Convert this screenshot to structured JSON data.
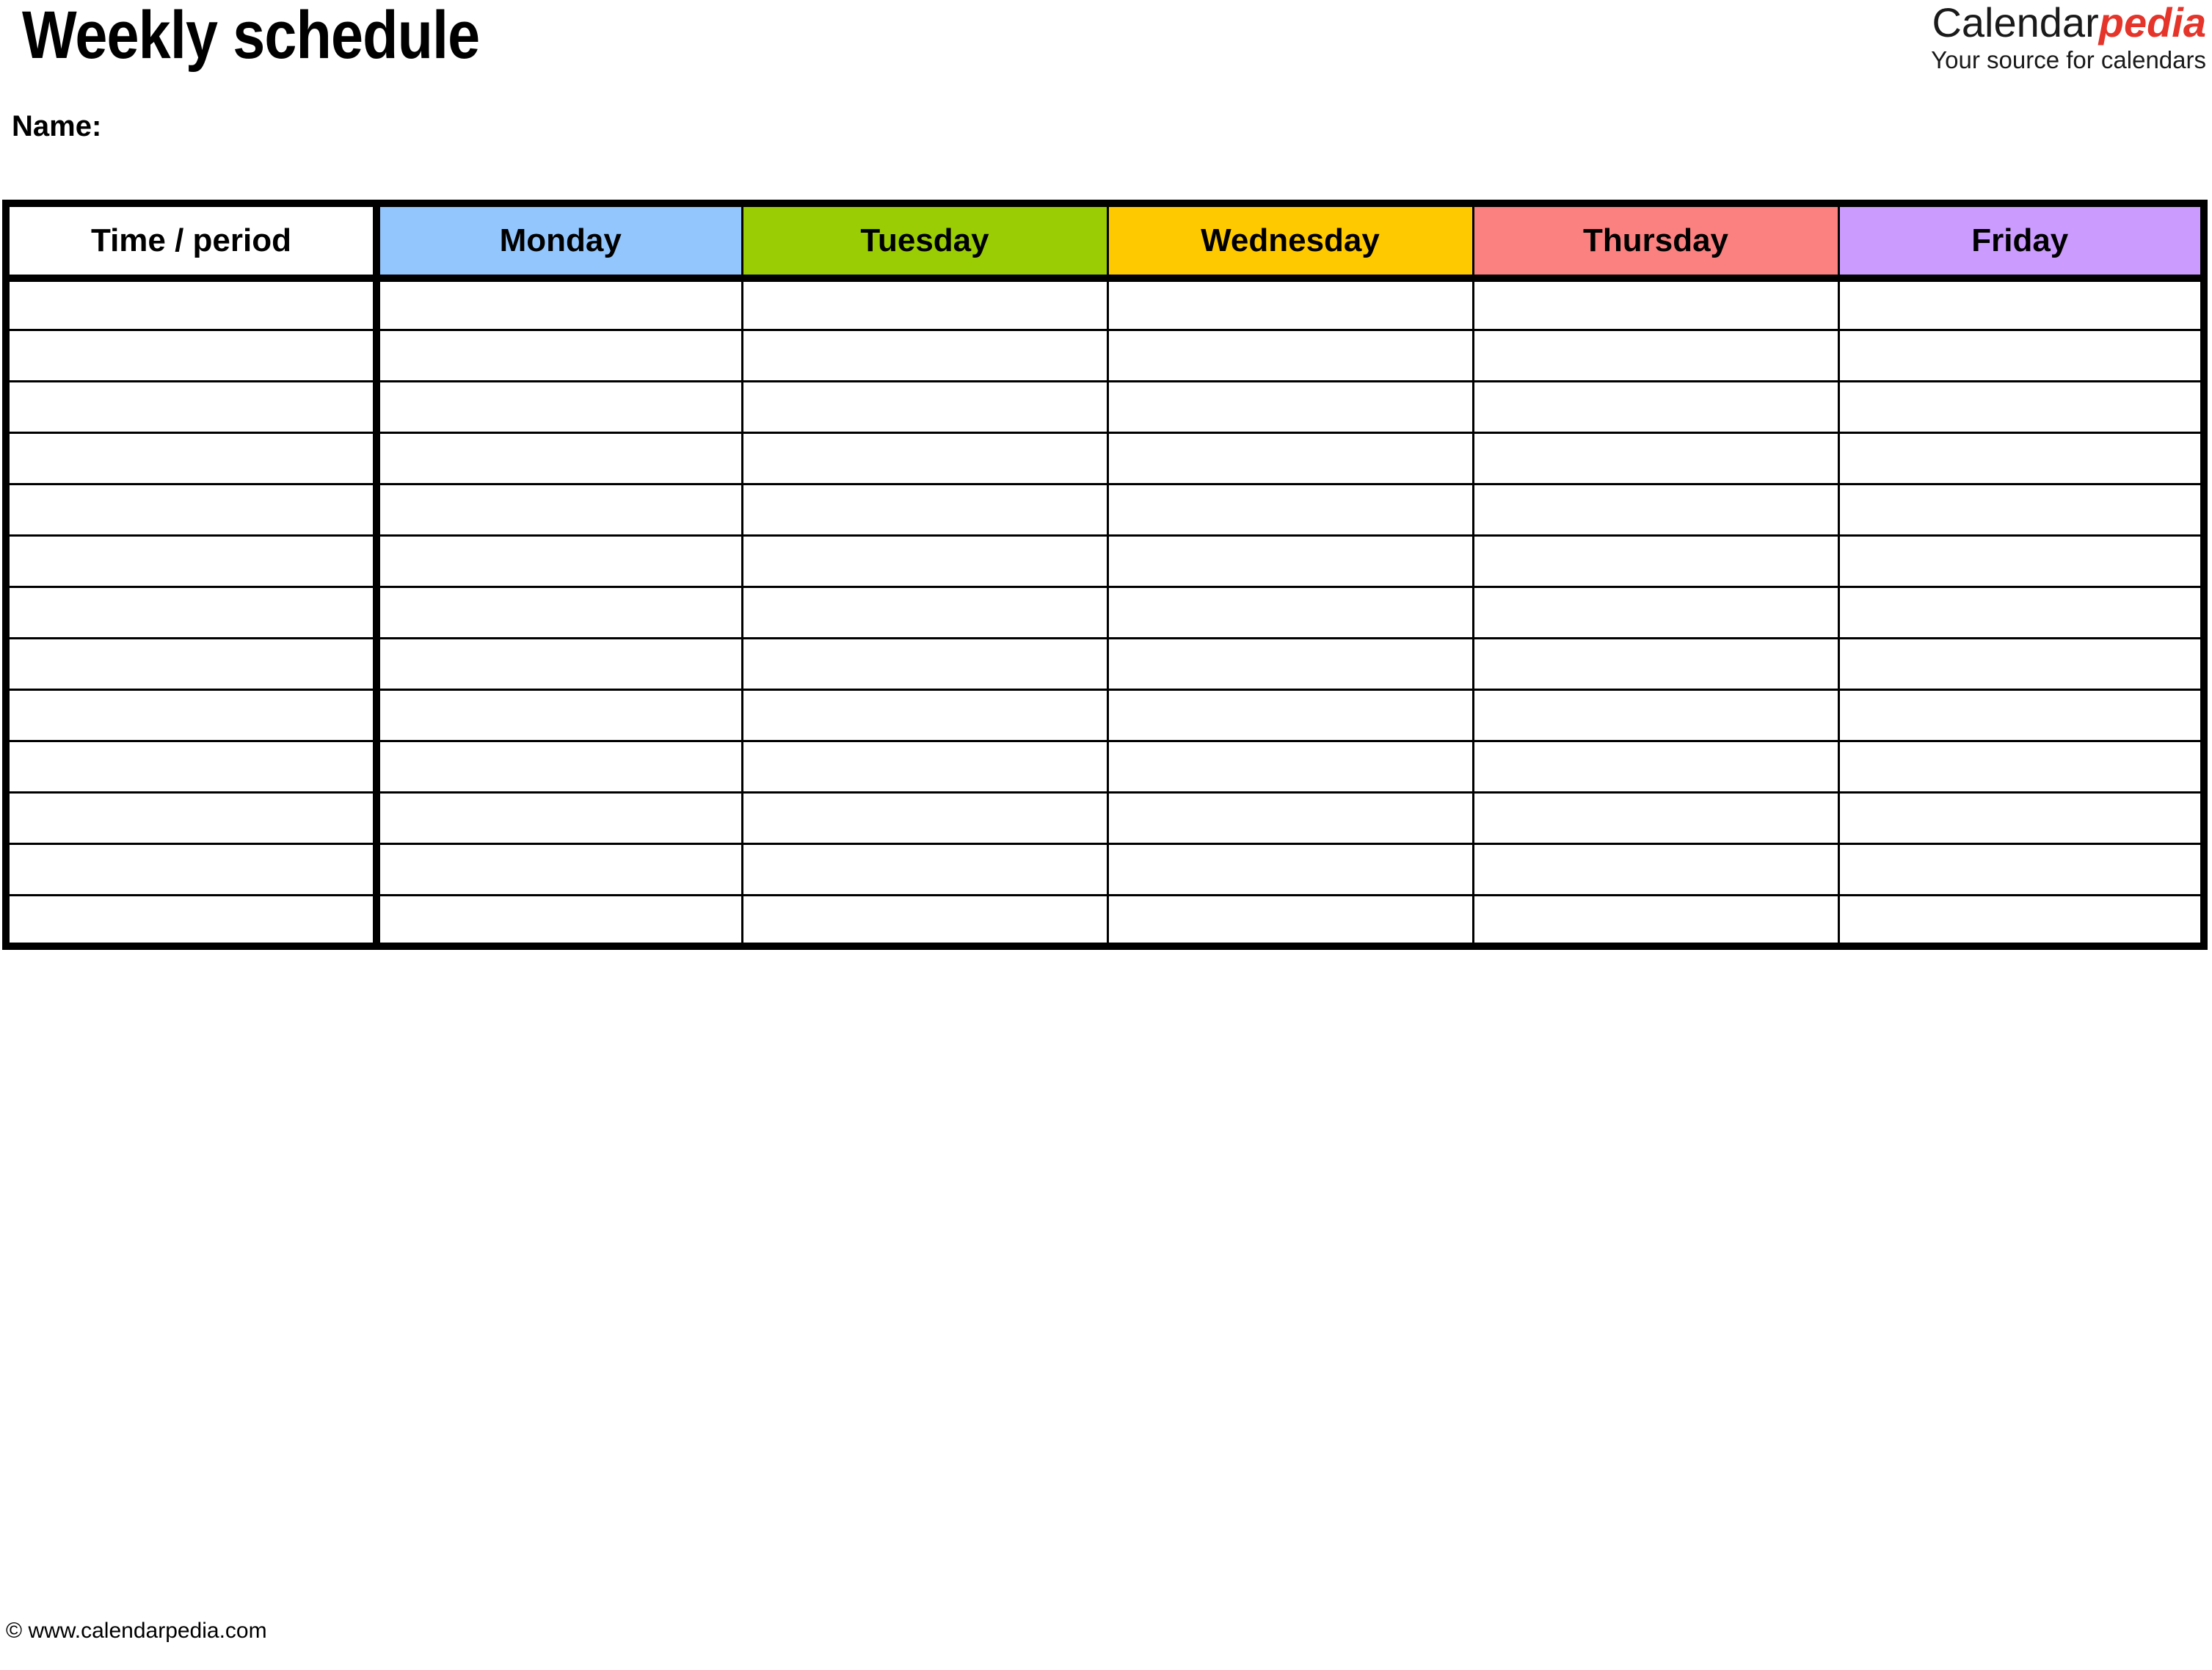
{
  "document": {
    "title": "Weekly schedule",
    "name_label": "Name:"
  },
  "logo": {
    "brand_first": "Calendar",
    "brand_second": "pedia",
    "tagline": "Your source for calendars",
    "brand_second_color": "#e5342a",
    "brand_first_color": "#1a1a1a"
  },
  "table": {
    "columns": [
      {
        "label": "Time / period",
        "color": "#ffffff",
        "key": "time"
      },
      {
        "label": "Monday",
        "color": "#93c6fd",
        "key": "monday"
      },
      {
        "label": "Tuesday",
        "color": "#9acd04",
        "key": "tuesday"
      },
      {
        "label": "Wednesday",
        "color": "#ffc900",
        "key": "wednesday"
      },
      {
        "label": "Thursday",
        "color": "#fb8180",
        "key": "thursday"
      },
      {
        "label": "Friday",
        "color": "#cb9bfd",
        "key": "friday"
      }
    ],
    "row_count": 13,
    "rows": [
      {
        "time": "",
        "monday": "",
        "tuesday": "",
        "wednesday": "",
        "thursday": "",
        "friday": ""
      },
      {
        "time": "",
        "monday": "",
        "tuesday": "",
        "wednesday": "",
        "thursday": "",
        "friday": ""
      },
      {
        "time": "",
        "monday": "",
        "tuesday": "",
        "wednesday": "",
        "thursday": "",
        "friday": ""
      },
      {
        "time": "",
        "monday": "",
        "tuesday": "",
        "wednesday": "",
        "thursday": "",
        "friday": ""
      },
      {
        "time": "",
        "monday": "",
        "tuesday": "",
        "wednesday": "",
        "thursday": "",
        "friday": ""
      },
      {
        "time": "",
        "monday": "",
        "tuesday": "",
        "wednesday": "",
        "thursday": "",
        "friday": ""
      },
      {
        "time": "",
        "monday": "",
        "tuesday": "",
        "wednesday": "",
        "thursday": "",
        "friday": ""
      },
      {
        "time": "",
        "monday": "",
        "tuesday": "",
        "wednesday": "",
        "thursday": "",
        "friday": ""
      },
      {
        "time": "",
        "monday": "",
        "tuesday": "",
        "wednesday": "",
        "thursday": "",
        "friday": ""
      },
      {
        "time": "",
        "monday": "",
        "tuesday": "",
        "wednesday": "",
        "thursday": "",
        "friday": ""
      },
      {
        "time": "",
        "monday": "",
        "tuesday": "",
        "wednesday": "",
        "thursday": "",
        "friday": ""
      },
      {
        "time": "",
        "monday": "",
        "tuesday": "",
        "wednesday": "",
        "thursday": "",
        "friday": ""
      },
      {
        "time": "",
        "monday": "",
        "tuesday": "",
        "wednesday": "",
        "thursday": "",
        "friday": ""
      }
    ]
  },
  "footer": {
    "copyright": "© www.calendarpedia.com"
  }
}
